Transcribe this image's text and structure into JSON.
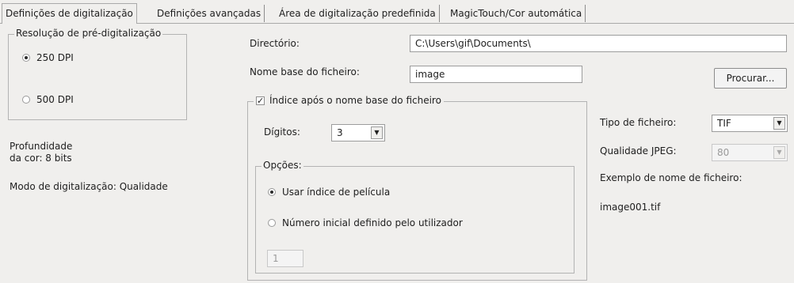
{
  "tabs": [
    {
      "label": "Definições de digitalização",
      "active": true
    },
    {
      "label": "Definições avançadas",
      "active": false
    },
    {
      "label": "Área de digitalização predefinida",
      "active": false
    },
    {
      "label": "MagicTouch/Cor automática",
      "active": false
    }
  ],
  "prescan": {
    "legend": "Resolução de pré-digitalização",
    "options": [
      {
        "label": "250 DPI",
        "selected": true
      },
      {
        "label": "500 DPI",
        "selected": false
      }
    ]
  },
  "info": {
    "depth_line1": "Profundidade",
    "depth_line2": "da cor: 8 bits",
    "mode": "Modo de digitalização: Qualidade"
  },
  "directory": {
    "label": "Directório:",
    "value": "C:\\Users\\gif\\Documents\\"
  },
  "basename": {
    "label": "Nome base do ficheiro:",
    "value": "image"
  },
  "browse_label": "Procurar...",
  "index": {
    "label": "Índice após o nome base do ficheiro",
    "checked": true,
    "digits_label": "Dígitos:",
    "digits_value": "3",
    "options_legend": "Opções:",
    "use_film_index": "Usar índice de película",
    "user_start": "Número inicial definido pelo utilizador",
    "start_value": "1"
  },
  "filetype": {
    "label": "Tipo de ficheiro:",
    "value": "TIF"
  },
  "jpeg": {
    "label": "Qualidade JPEG:",
    "value": "80"
  },
  "example": {
    "label": "Exemplo de nome de ficheiro:",
    "value": "image001.tif"
  }
}
